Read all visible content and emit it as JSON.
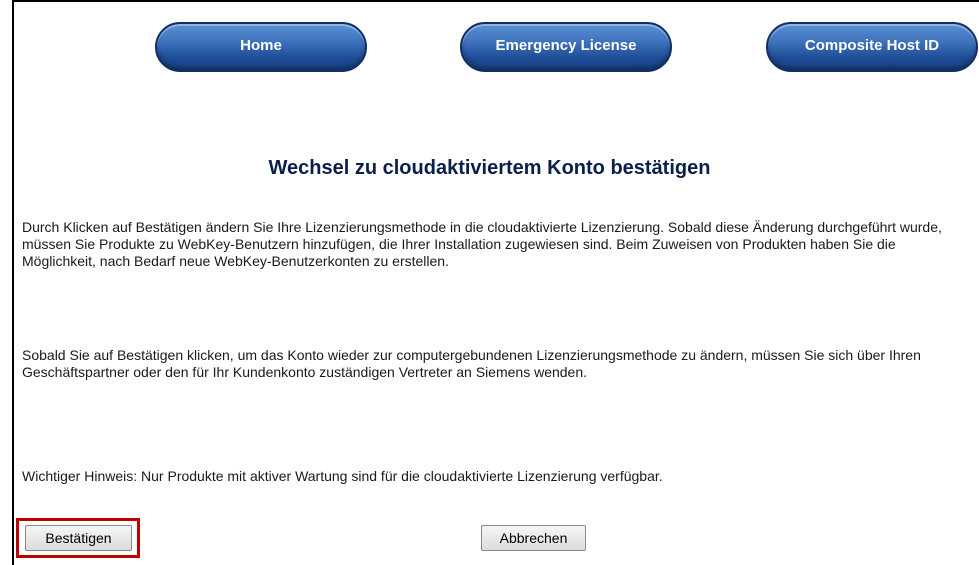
{
  "nav": {
    "home_label": "Home",
    "emergency_label": "Emergency License",
    "composite_label": "Composite Host ID"
  },
  "main": {
    "title": "Wechsel zu cloudaktiviertem Konto bestätigen",
    "paragraph1": "Durch Klicken auf Bestätigen ändern Sie Ihre Lizenzierungsmethode in die cloudaktivierte Lizenzierung. Sobald diese Änderung durchgeführt wurde, müssen Sie Produkte zu WebKey-Benutzern hinzufügen, die Ihrer Installation zugewiesen sind. Beim Zuweisen von Produkten haben Sie die Möglichkeit, nach Bedarf neue WebKey-Benutzerkonten zu erstellen.",
    "paragraph2": "Sobald Sie auf Bestätigen klicken, um das Konto wieder zur computergebundenen Lizenzierungsmethode zu ändern, müssen Sie sich über Ihren Geschäftspartner oder den für Ihr Kundenkonto zuständigen Vertreter an Siemens wenden.",
    "paragraph3": "Wichtiger Hinweis: Nur Produkte mit aktiver Wartung sind für die cloudaktivierte Lizenzierung verfügbar."
  },
  "actions": {
    "confirm_label": "Bestätigen",
    "cancel_label": "Abbrechen"
  },
  "colors": {
    "nav_button": "#2b5fa8",
    "title": "#0b1f4d",
    "highlight": "#c00000"
  }
}
